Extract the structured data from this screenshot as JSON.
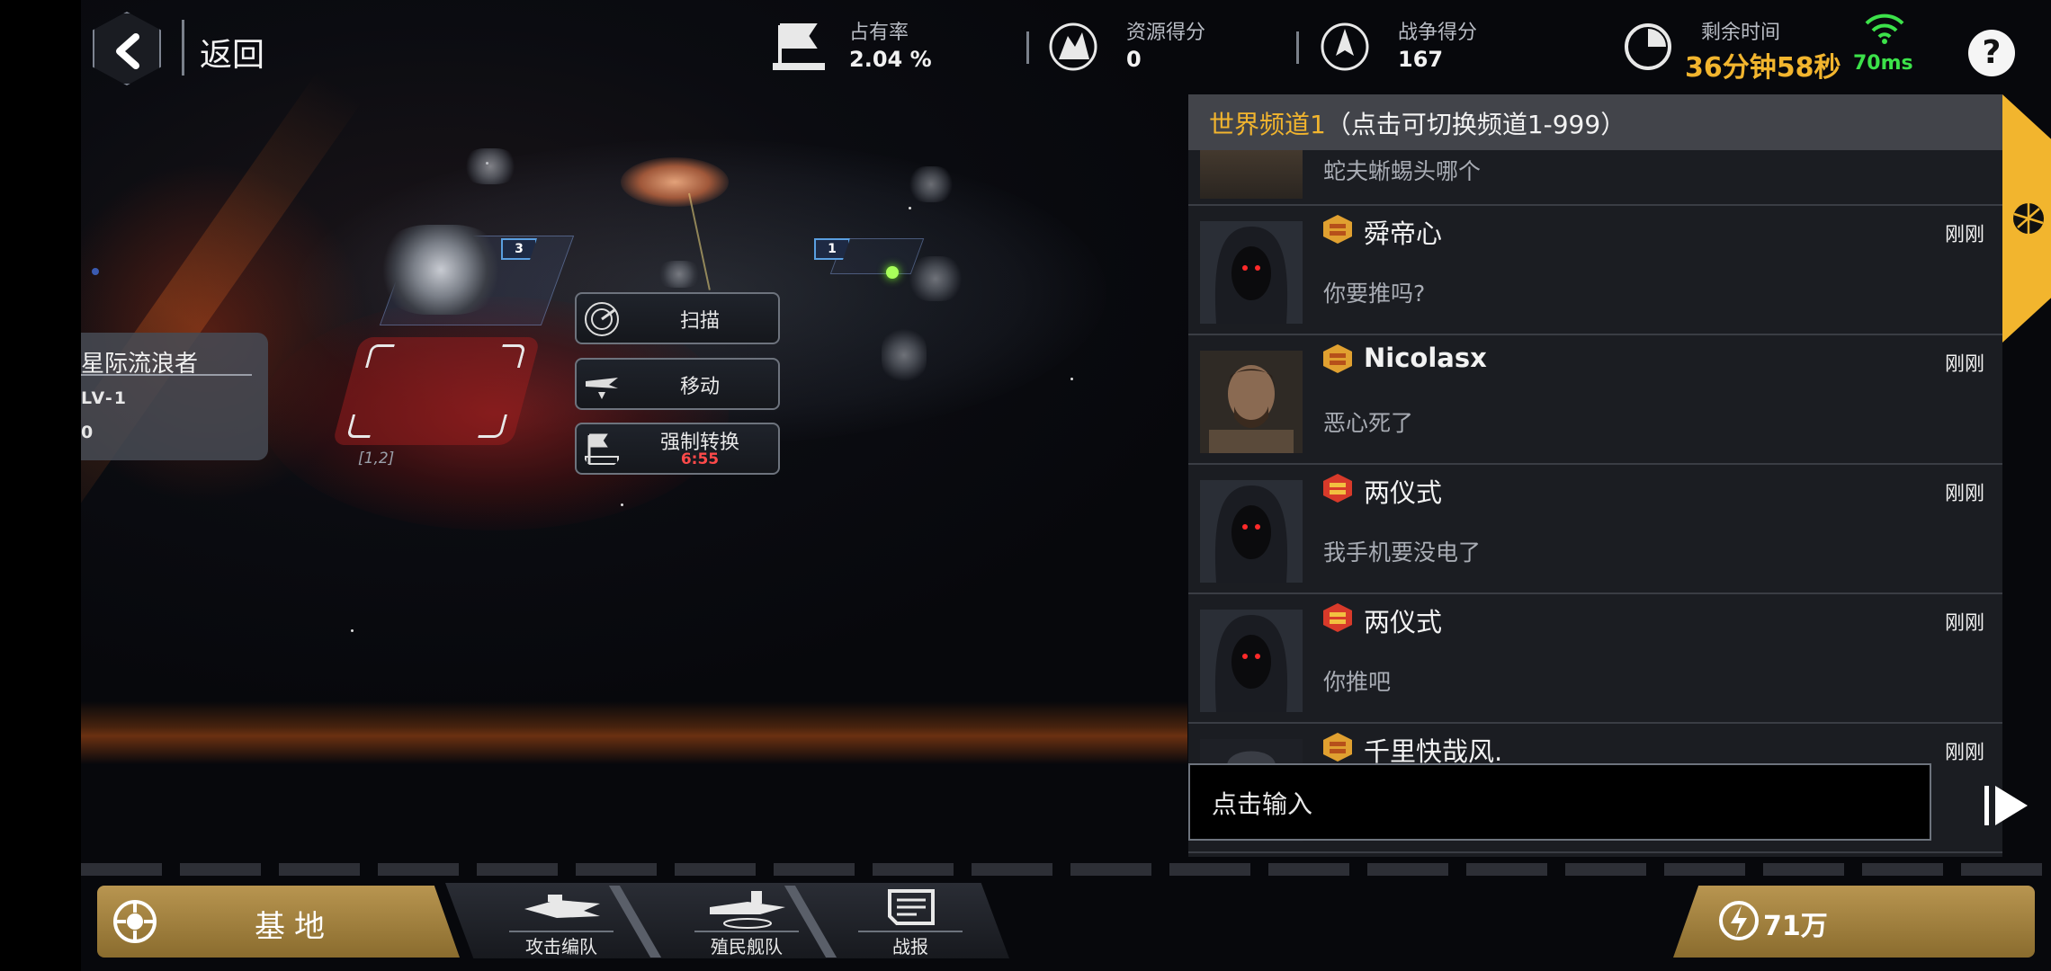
{
  "topbar": {
    "back_label": "返回",
    "stats": [
      {
        "caption": "占有率",
        "value": "2.04 %",
        "icon": "flag-icon"
      },
      {
        "caption": "资源得分",
        "value": "0",
        "icon": "resource-icon"
      },
      {
        "caption": "战争得分",
        "value": "167",
        "icon": "war-icon"
      },
      {
        "caption": "剩余时间",
        "value": "36分钟58秒",
        "icon": "clock-icon"
      }
    ],
    "ping": "70ms",
    "help": "?"
  },
  "map": {
    "player_card": {
      "name": "星际流浪者",
      "level": "LV-1",
      "extra": "0"
    },
    "tile_level_left": "3",
    "tile_level_right": "1",
    "coordinate": "[1,2]",
    "actions": [
      {
        "label": "扫描",
        "icon": "radar-icon"
      },
      {
        "label": "移动",
        "icon": "move-ship-icon"
      },
      {
        "label": "强制转换",
        "timer": "6:55",
        "icon": "force-convert-icon"
      }
    ]
  },
  "chat": {
    "channel_highlight": "世界频道1",
    "channel_rest": "（点击可切换频道1-999）",
    "partial_message": "蛇夫蜥蜴头哪个",
    "messages": [
      {
        "name": "舜帝心",
        "time": "刚刚",
        "text": "你要推吗?",
        "avatar": "hooded",
        "rank": "gold"
      },
      {
        "name": "Nicolasx",
        "time": "刚刚",
        "text": "恶心死了",
        "avatar": "soldier",
        "rank": "gold"
      },
      {
        "name": "两仪式",
        "time": "刚刚",
        "text": "我手机要没电了",
        "avatar": "hooded",
        "rank": "red"
      },
      {
        "name": "两仪式",
        "time": "刚刚",
        "text": "你推吧",
        "avatar": "hooded",
        "rank": "red"
      },
      {
        "name": "千里快哉风.",
        "time": "刚刚",
        "text": "",
        "avatar": "helmet",
        "rank": "gold"
      }
    ],
    "input_placeholder": "点击输入"
  },
  "bottom": {
    "base_label": "基地",
    "nav": [
      {
        "label": "攻击编队",
        "icon": "attack-fleet-icon"
      },
      {
        "label": "殖民舰队",
        "icon": "colony-fleet-icon"
      },
      {
        "label": "战报",
        "icon": "battle-report-icon"
      }
    ],
    "resource_label": "71万"
  },
  "colors": {
    "accent": "#f2b52e",
    "gold_button": "#b89550",
    "ping_green": "#3ce24a",
    "timer_red": "#ff4a4a"
  }
}
